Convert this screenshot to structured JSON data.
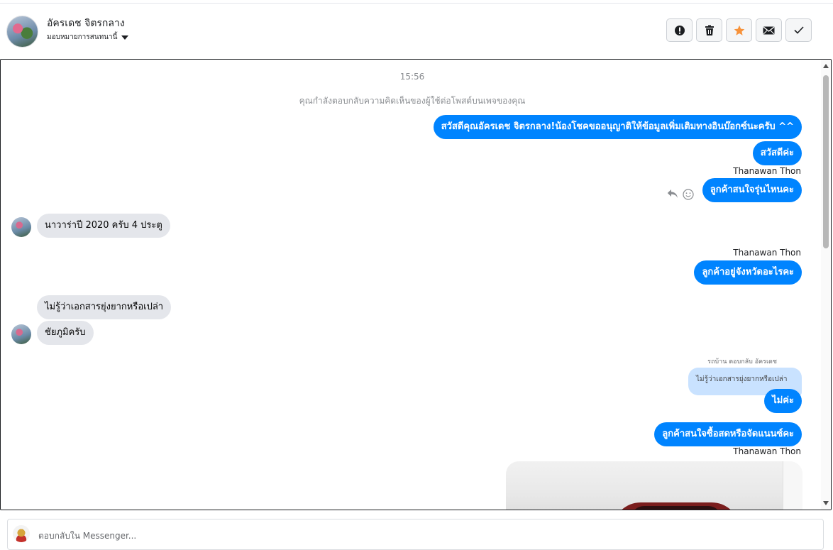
{
  "header": {
    "contact_name": "อัครเดช จิตรกลาง",
    "assign_label": "มอบหมายการสนทนานี้",
    "actions": [
      {
        "name": "spam-icon",
        "label": "!"
      },
      {
        "name": "trash-icon",
        "label": "delete"
      },
      {
        "name": "star-icon",
        "label": "star"
      },
      {
        "name": "mail-icon",
        "label": "mail"
      },
      {
        "name": "check-icon",
        "label": "done"
      }
    ],
    "star_color": "#f7923a"
  },
  "chat": {
    "timestamp": "15:56",
    "notice": "คุณกำลังตอบกลับความคิดเห็นของผู้ใช้ต่อโพสต์บนเพจของคุณ",
    "messages": [
      {
        "text": "สวัสดีคุณอัครเดช จิตรกลาง!น้องโชคขออนุญาติให้ข้อมูลเพิ่มเติมทางอินบ๊อกซ์นะครับ ^^"
      },
      {
        "text": "สวัสดีค่ะ"
      },
      {
        "text": "Thanawan Thon"
      },
      {
        "text": "ลูกค้าสนใจรุ่นไหนคะ"
      },
      {
        "text": "นาวาร่าปี 2020 ครับ 4 ประตู"
      },
      {
        "text": "Thanawan Thon"
      },
      {
        "text": "ลูกค้าอยู่จังหวัดอะไรคะ"
      },
      {
        "text": "ไม่รู้ว่าเอกสารยุ่งยากหรือเปล่า"
      },
      {
        "text": "ชัยภูมิครับ"
      },
      {
        "text": "รถบ้าน ตอบกลับ อัครเดช"
      },
      {
        "text": "ไม่รู้ว่าเอกสารยุ่งยากหรือเปล่า"
      },
      {
        "text": "ไม่ค่ะ"
      },
      {
        "text": "ลูกค้าสนใจซื้อสดหรือจัดแนนซ์คะ"
      },
      {
        "text": "Thanawan Thon"
      }
    ],
    "brand_blue": "#0084ff"
  },
  "composer": {
    "placeholder": "ตอบกลับใน Messenger..."
  }
}
